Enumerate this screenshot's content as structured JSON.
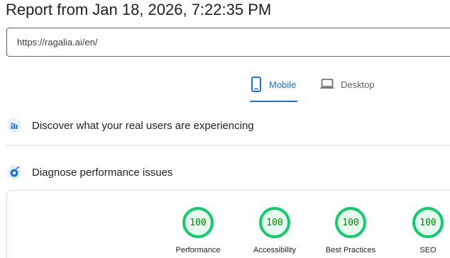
{
  "report": {
    "title": "Report from Jan 18, 2026, 7:22:35 PM"
  },
  "url_field": {
    "value": "https://ragalia.ai/en/"
  },
  "device_tabs": [
    {
      "label": "Mobile",
      "icon": "smartphone-icon",
      "selected": true
    },
    {
      "label": "Desktop",
      "icon": "laptop-icon",
      "selected": false
    }
  ],
  "sections": {
    "discover": {
      "label": "Discover what your real users are experiencing",
      "icon": "users-experience-icon"
    },
    "diagnose": {
      "label": "Diagnose performance issues",
      "icon": "lighthouse-icon"
    }
  },
  "scores": [
    {
      "label": "Performance",
      "value": "100"
    },
    {
      "label": "Accessibility",
      "value": "100"
    },
    {
      "label": "Best Practices",
      "value": "100"
    },
    {
      "label": "SEO",
      "value": "100"
    }
  ],
  "colors": {
    "accent": "#1a73e8",
    "score_good": "#0cce6b",
    "score_text": "#008800",
    "score_fill": "#e7f9ef"
  }
}
